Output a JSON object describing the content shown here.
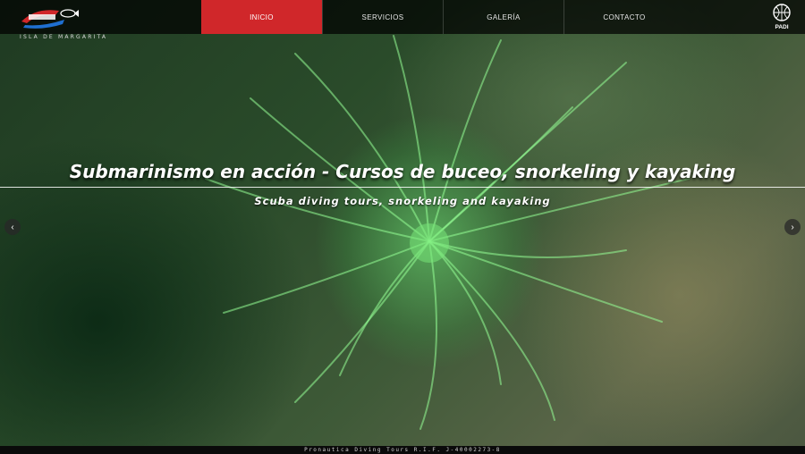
{
  "header": {
    "logo_name": "pronautica-logo",
    "logo_subtitle": "ISLA DE MARGARITA",
    "partner_logo_text": "PADI",
    "nav": [
      {
        "label": "INICIO",
        "active": true
      },
      {
        "label": "SERVICIOS",
        "active": false
      },
      {
        "label": "GALERÍA",
        "active": false
      },
      {
        "label": "CONTACTO",
        "active": false
      }
    ]
  },
  "hero": {
    "title": "Submarinismo en acción - Cursos de buceo, snorkeling y kayaking",
    "subtitle": "Scuba diving tours, snorkeling and kayaking",
    "prev_icon": "chevron-left-icon",
    "next_icon": "chevron-right-icon"
  },
  "footer": {
    "text": "Pronautica Diving Tours R.I.F. J-40002273-8"
  },
  "colors": {
    "accent": "#d0272a",
    "topbar": "#000000",
    "text": "#ffffff"
  }
}
